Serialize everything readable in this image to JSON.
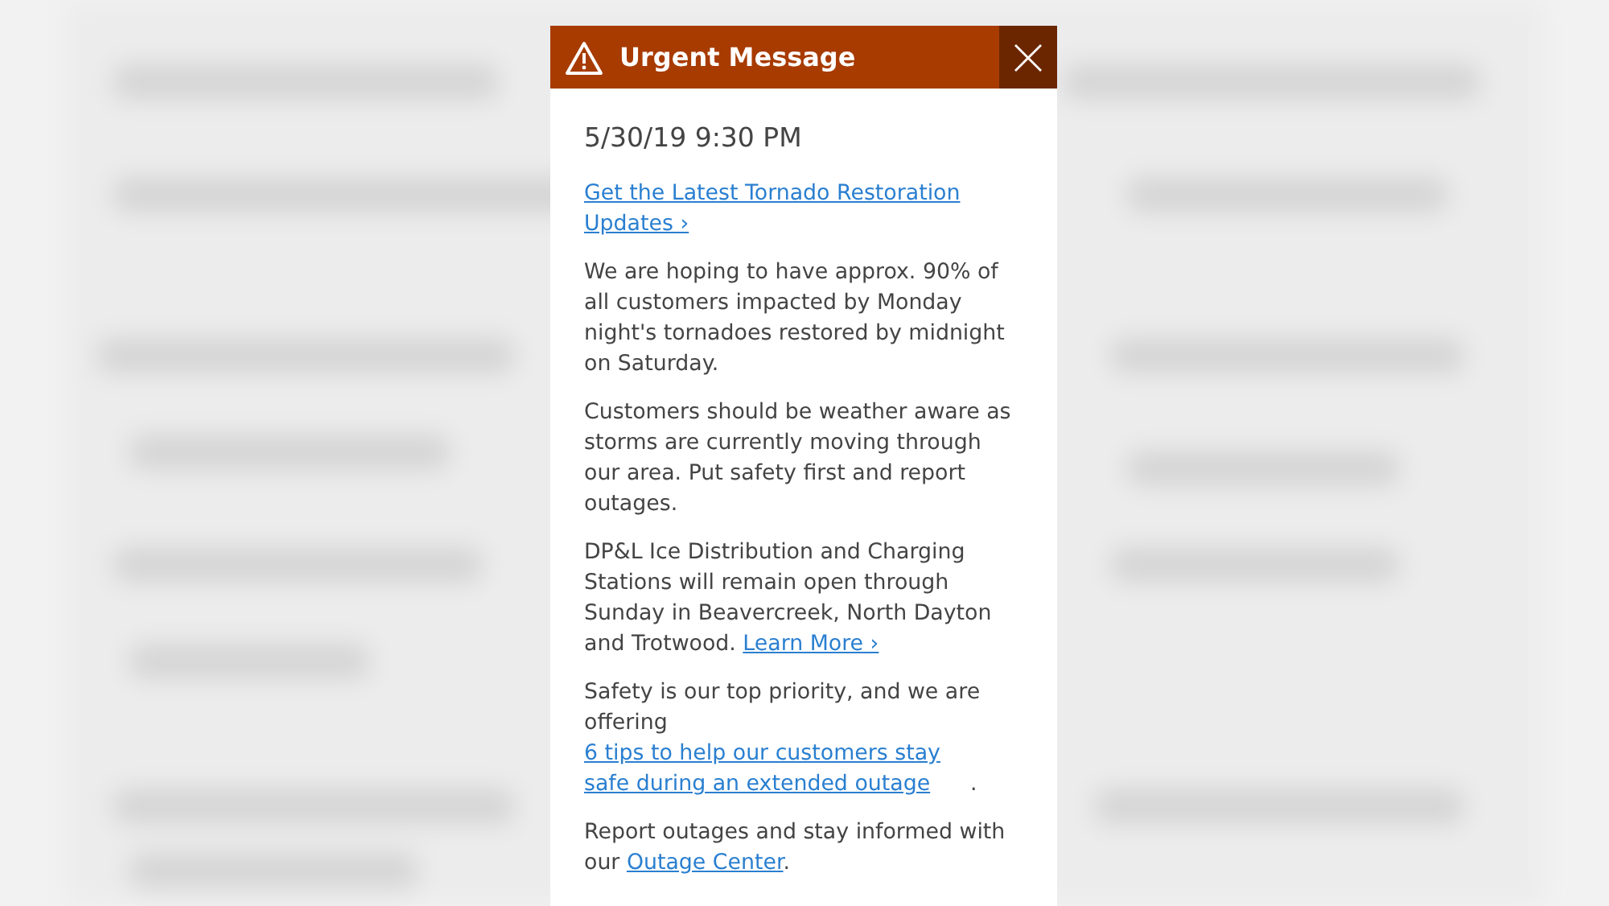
{
  "dialog": {
    "title": "Urgent Message",
    "timestamp": "5/30/19 9:30 PM",
    "headline_link": "Get the Latest Tornado Restoration Updates ›",
    "paragraphs": [
      [
        {
          "kind": "text",
          "text": "We are hoping to have approx. 90% of all customers impacted by Monday night's tornadoes restored by midnight on Saturday."
        }
      ],
      [
        {
          "kind": "text",
          "text": "Customers should be weather aware as storms are currently moving through our area. Put safety first and report outages."
        }
      ],
      [
        {
          "kind": "text",
          "text": "DP&L Ice Distribution and Charging Stations will remain open through Sunday in Beavercreek, North Dayton and Trotwood. "
        },
        {
          "kind": "link",
          "text": "Learn More ›"
        }
      ],
      [
        {
          "kind": "text",
          "text": "Safety is our top priority, and we are offering "
        },
        {
          "kind": "link",
          "text": "6 tips to help our customers stay safe during an extended outage"
        },
        {
          "kind": "text",
          "text": "."
        }
      ],
      [
        {
          "kind": "text",
          "text": "Report outages and stay informed with our "
        },
        {
          "kind": "link",
          "text": "Outage Center"
        },
        {
          "kind": "text",
          "text": "."
        }
      ]
    ]
  }
}
